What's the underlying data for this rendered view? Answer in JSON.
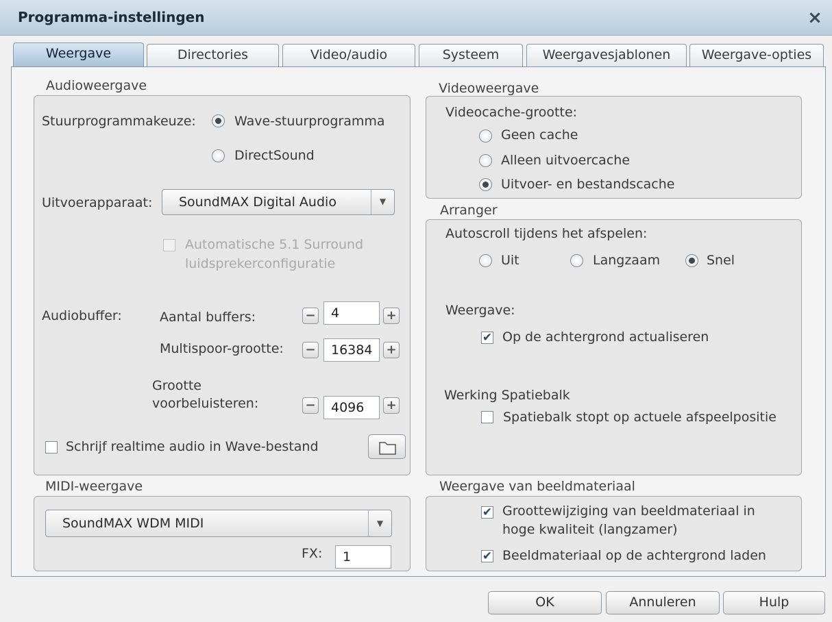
{
  "window": {
    "title": "Programma-instellingen",
    "close": "×"
  },
  "tabs": [
    "Weergave",
    "Directories",
    "Video/audio",
    "Systeem",
    "Weergavesjablonen",
    "Weergave-opties"
  ],
  "audio": {
    "group_title": "Audioweergave",
    "driver_label": "Stuurprogrammakeuze:",
    "driver_options": [
      "Wave-stuurprogramma",
      "DirectSound"
    ],
    "driver_selected": "Wave-stuurprogramma",
    "output_label": "Uitvoerapparaat:",
    "output_value": "SoundMAX Digital Audio",
    "surround_line1": "Automatische 5.1 Surround",
    "surround_line2": "luidsprekerconfiguratie",
    "buffer_label": "Audiobuffer:",
    "buffers_label": "Aantal buffers:",
    "buffers_value": "4",
    "multitrack_label": "Multispoor-grootte:",
    "multitrack_value": "16384",
    "preview_label_1": "Grootte",
    "preview_label_2": "voorbeluisteren:",
    "preview_value": "4096",
    "write_realtime": "Schrijf realtime audio in Wave-bestand",
    "minus": "−",
    "plus": "+"
  },
  "midi": {
    "group_title": "MIDI-weergave",
    "device": "SoundMAX WDM MIDI",
    "fx_label": "FX:",
    "fx_value": "1"
  },
  "video": {
    "group_title": "Videoweergave",
    "cache_label": "Videocache-grootte:",
    "options": [
      "Geen cache",
      "Alleen uitvoercache",
      "Uitvoer- en bestandscache"
    ],
    "selected": "Uitvoer- en bestandscache"
  },
  "arranger": {
    "group_title": "Arranger",
    "autoscroll_label": "Autoscroll tijdens het afspelen:",
    "autoscroll_options": [
      "Uit",
      "Langzaam",
      "Snel"
    ],
    "autoscroll_selected": "Snel",
    "display_label": "Weergave:",
    "background_update": "Op de achtergrond actualiseren",
    "spacebar_label": "Werking Spatiebalk",
    "spacebar_option": "Spatiebalk stopt op actuele afspeelpositie"
  },
  "images": {
    "group_title": "Weergave van beeldmateriaal",
    "resize_line1": "Groottewijziging van beeldmateriaal in",
    "resize_line2": "hoge kwaliteit (langzamer)",
    "background_load": "Beeldmateriaal op de achtergrond laden"
  },
  "buttons": {
    "ok": "OK",
    "cancel": "Annuleren",
    "help": "Hulp"
  }
}
